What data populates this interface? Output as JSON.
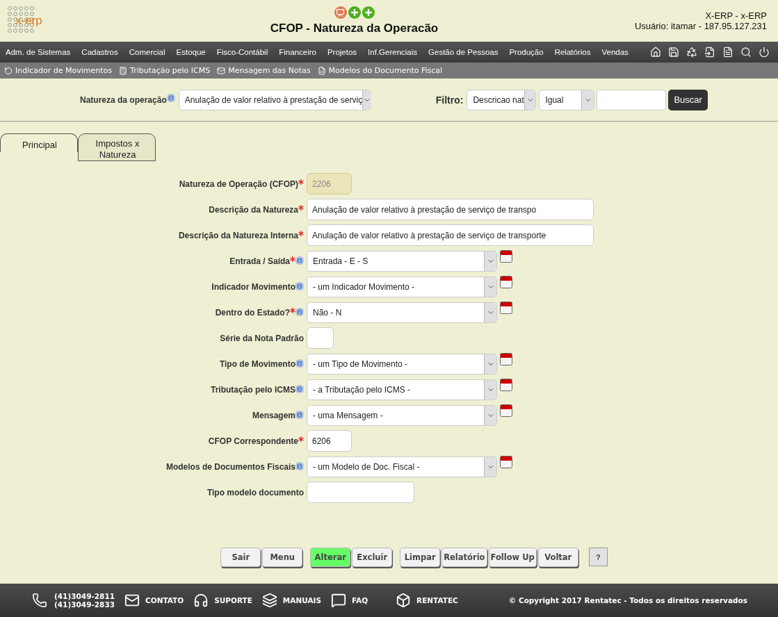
{
  "header": {
    "logo_text": "x-erp",
    "title": "CFOP - Natureza da Operacão",
    "system": "X-ERP - x-ERP",
    "user": "Usuário: itamar - 187.95.127.231"
  },
  "menu": [
    "Adm. de Sistemas",
    "Cadastros",
    "Comercial",
    "Estoque",
    "Fisco-Contábil",
    "Financeiro",
    "Projetos",
    "Inf.Gerenciais",
    "Gestão de Pessoas",
    "Produção",
    "Relatórios",
    "Vendas"
  ],
  "submenu": [
    "Indicador de Movimentos",
    "Tributação pelo ICMS",
    "Mensagem das Notas",
    "Modelos do Documento Fiscal"
  ],
  "search": {
    "label": "Natureza da operação",
    "value": "Anulação de valor relativo à prestação de serviç",
    "filter_label": "Filtro:",
    "field": "Descricao nat",
    "operator": "Igual",
    "button": "Buscar"
  },
  "tabs": [
    {
      "label": "Principal",
      "selected": true
    },
    {
      "label": "Impostos x Natureza",
      "selected": false
    }
  ],
  "fields": [
    {
      "label": "Natureza de Operação (CFOP)",
      "required": true,
      "info": false,
      "kind": "readonly",
      "value": "2206"
    },
    {
      "label": "Descrição da Natureza",
      "required": true,
      "info": false,
      "kind": "text",
      "value": "Anulação de valor relativo à prestação de serviço de transpo"
    },
    {
      "label": "Descrição da Natureza Interna",
      "required": true,
      "info": false,
      "kind": "text",
      "value": "Anulação de valor relativo à prestação de serviço de transporte"
    },
    {
      "label": "Entrada / Saída",
      "required": true,
      "info": true,
      "kind": "select",
      "value": "Entrada - E - S"
    },
    {
      "label": "Indicador Movimento",
      "required": false,
      "info": true,
      "kind": "select",
      "value": "- um Indicador Movimento -"
    },
    {
      "label": "Dentro do Estado?",
      "required": true,
      "info": true,
      "kind": "select",
      "value": "Não - N"
    },
    {
      "label": "Série da Nota Padrão",
      "required": false,
      "info": false,
      "kind": "tiny"
    },
    {
      "label": "Tipo de Movimento",
      "required": false,
      "info": true,
      "kind": "select",
      "value": "- um Tipo de Movimento -"
    },
    {
      "label": "Tributação pelo ICMS",
      "required": false,
      "info": true,
      "kind": "select",
      "value": "- a Tributação pelo ICMS -"
    },
    {
      "label": "Mensagem",
      "required": false,
      "info": true,
      "kind": "select",
      "value": "- uma Mensagem -"
    },
    {
      "label": "CFOP Correspondente",
      "required": true,
      "info": false,
      "kind": "code",
      "value": "6206"
    },
    {
      "label": "Modelos de Documentos Fiscais",
      "required": false,
      "info": true,
      "kind": "select",
      "value": "- um Modelo de Doc. Fiscal -"
    },
    {
      "label": "Tipo modelo documento",
      "required": false,
      "info": false,
      "kind": "medium"
    }
  ],
  "button_groups": [
    [
      {
        "label": "Sair",
        "primary": false
      },
      {
        "label": "Menu",
        "primary": false
      }
    ],
    [
      {
        "label": "Alterar",
        "primary": true
      },
      {
        "label": "Excluir",
        "primary": false
      }
    ],
    [
      {
        "label": "Limpar",
        "primary": false
      },
      {
        "label": "Relatório",
        "primary": false
      },
      {
        "label": "Follow Up",
        "primary": false
      },
      {
        "label": "Voltar",
        "primary": false
      }
    ]
  ],
  "help_button": "?",
  "footer": {
    "phones": [
      "(41)3049-2811",
      "(41)3049-2833"
    ],
    "links": [
      {
        "kind": "mail",
        "label": "CONTATO"
      },
      {
        "kind": "headset",
        "label": "SUPORTE"
      },
      {
        "kind": "books",
        "label": "MANUAIS"
      },
      {
        "kind": "faq",
        "label": "FAQ"
      },
      {
        "kind": "cube",
        "label": "RENTATEC"
      }
    ],
    "copyright": "© Copyright 2017 Rentatec - Todos os direitos reservados"
  }
}
